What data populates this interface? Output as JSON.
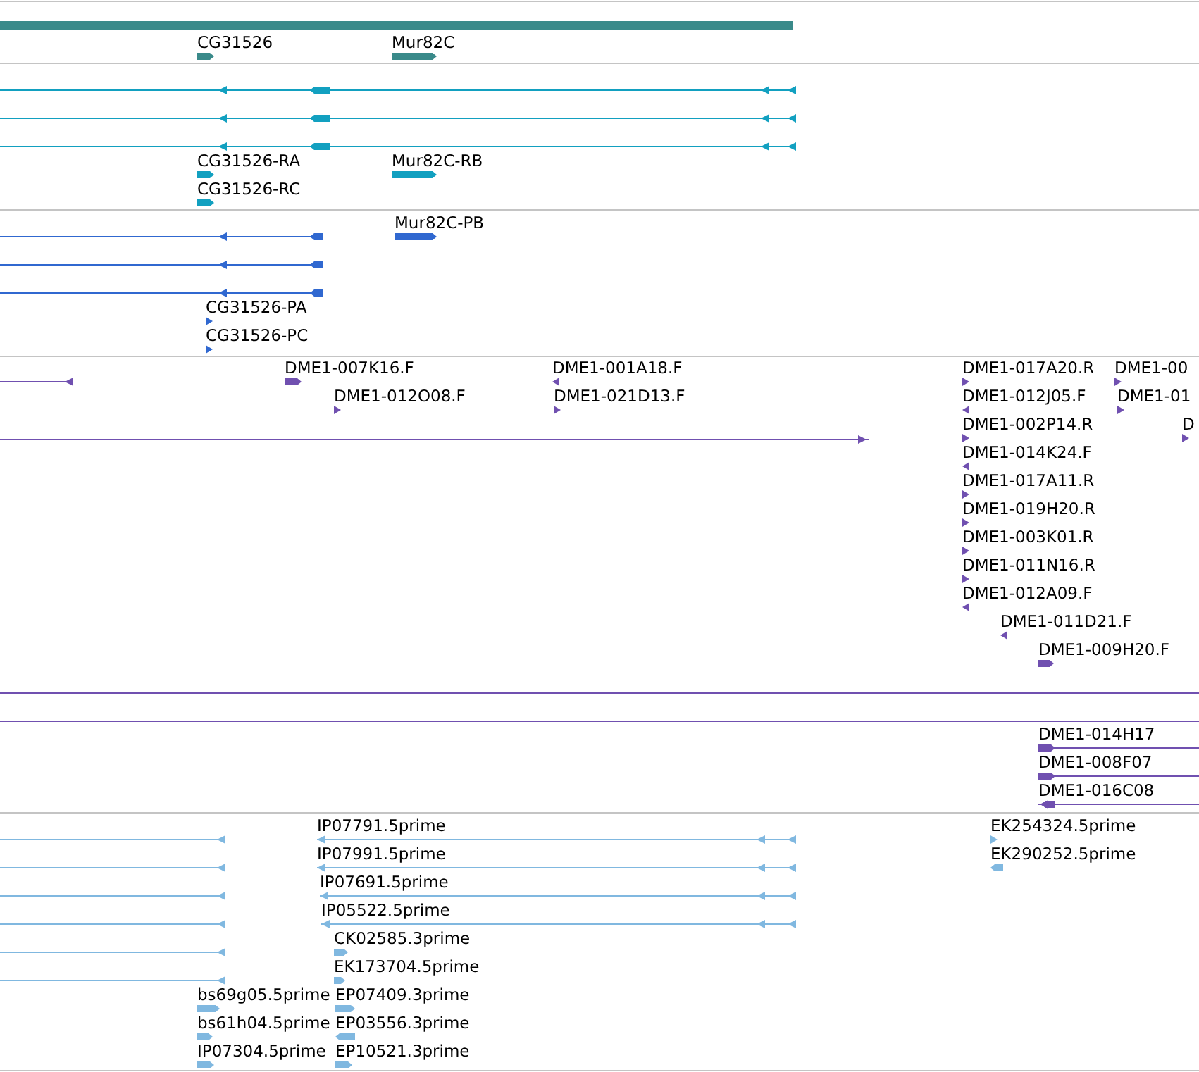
{
  "tracks": [
    {
      "color": "#3a8a8a",
      "features": [
        {
          "kind": "bar"
        },
        {
          "kind": "read",
          "label": "CG31526",
          "reverse": false
        },
        {
          "kind": "read",
          "label": "Mur82C",
          "reverse": false
        }
      ]
    },
    {
      "color": "#12a0c0",
      "features": [
        {
          "kind": "transcript",
          "reverse": true
        },
        {
          "kind": "transcript",
          "reverse": true
        },
        {
          "kind": "transcript",
          "reverse": true
        },
        {
          "kind": "read",
          "label": "CG31526-RA",
          "reverse": false
        },
        {
          "kind": "read",
          "label": "Mur82C-RB",
          "reverse": false
        },
        {
          "kind": "read",
          "label": "CG31526-RC",
          "reverse": false
        }
      ]
    },
    {
      "color": "#3068d0",
      "features": [
        {
          "kind": "read",
          "label": "Mur82C-PB",
          "reverse": false
        },
        {
          "kind": "transcript",
          "reverse": true
        },
        {
          "kind": "transcript",
          "reverse": true
        },
        {
          "kind": "transcript",
          "reverse": true
        },
        {
          "kind": "read",
          "label": "CG31526-PA",
          "reverse": false
        },
        {
          "kind": "read",
          "label": "CG31526-PC",
          "reverse": false
        }
      ]
    },
    {
      "color": "#7050b0",
      "features": [
        {
          "kind": "transcript",
          "reverse": true
        },
        {
          "kind": "read",
          "label": "DME1-007K16.F",
          "reverse": false
        },
        {
          "kind": "read",
          "label": "DME1-001A18.F",
          "reverse": true
        },
        {
          "kind": "read",
          "label": "DME1-017A20.R",
          "reverse": false
        },
        {
          "kind": "read",
          "label": "DME1-00",
          "reverse": false
        },
        {
          "kind": "read",
          "label": "DME1-012O08.F",
          "reverse": false
        },
        {
          "kind": "read",
          "label": "DME1-021D13.F",
          "reverse": false
        },
        {
          "kind": "read",
          "label": "DME1-012J05.F",
          "reverse": true
        },
        {
          "kind": "read",
          "label": "DME1-01",
          "reverse": false
        },
        {
          "kind": "transcript",
          "reverse": false
        },
        {
          "kind": "read",
          "label": "DME1-002P14.R",
          "reverse": false
        },
        {
          "kind": "read",
          "label": "D",
          "reverse": false
        },
        {
          "kind": "read",
          "label": "DME1-014K24.F",
          "reverse": true
        },
        {
          "kind": "read",
          "label": "DME1-017A11.R",
          "reverse": false
        },
        {
          "kind": "read",
          "label": "DME1-019H20.R",
          "reverse": false
        },
        {
          "kind": "read",
          "label": "DME1-003K01.R",
          "reverse": false
        },
        {
          "kind": "read",
          "label": "DME1-011N16.R",
          "reverse": false
        },
        {
          "kind": "read",
          "label": "DME1-012A09.F",
          "reverse": true
        },
        {
          "kind": "read",
          "label": "DME1-011D21.F",
          "reverse": true
        },
        {
          "kind": "read",
          "label": "DME1-009H20.F",
          "reverse": false
        },
        {
          "kind": "line"
        },
        {
          "kind": "line"
        },
        {
          "kind": "transcript",
          "label": "DME1-014H17",
          "reverse": false
        },
        {
          "kind": "transcript",
          "label": "DME1-008F07",
          "reverse": false
        },
        {
          "kind": "transcript",
          "label": "DME1-016C08",
          "reverse": true
        }
      ]
    },
    {
      "color": "#80b8e0",
      "features": [
        {
          "kind": "transcript",
          "reverse": true
        },
        {
          "kind": "transcript",
          "reverse": true
        },
        {
          "kind": "transcript",
          "reverse": true
        },
        {
          "kind": "transcript",
          "reverse": true
        },
        {
          "kind": "transcript",
          "reverse": true
        },
        {
          "kind": "transcript",
          "reverse": true
        },
        {
          "kind": "transcript",
          "label": "IP07791.5prime",
          "reverse": true
        },
        {
          "kind": "read",
          "label": "EK254324.5prime",
          "reverse": false
        },
        {
          "kind": "transcript",
          "label": "IP07991.5prime",
          "reverse": true
        },
        {
          "kind": "read",
          "label": "EK290252.5prime",
          "reverse": true
        },
        {
          "kind": "transcript",
          "label": "IP07691.5prime",
          "reverse": true
        },
        {
          "kind": "transcript",
          "label": "IP05522.5prime",
          "reverse": true
        },
        {
          "kind": "read",
          "label": "CK02585.3prime",
          "reverse": false
        },
        {
          "kind": "read",
          "label": "EK173704.5prime",
          "reverse": false
        },
        {
          "kind": "read",
          "label": "bs69g05.5prime",
          "reverse": false
        },
        {
          "kind": "read",
          "label": "EP07409.3prime",
          "reverse": false
        },
        {
          "kind": "read",
          "label": "bs61h04.5prime",
          "reverse": false
        },
        {
          "kind": "read",
          "label": "EP03556.3prime",
          "reverse": true
        },
        {
          "kind": "read",
          "label": "IP07304.5prime",
          "reverse": false
        },
        {
          "kind": "read",
          "label": "EP10521.3prime",
          "reverse": false
        }
      ]
    }
  ]
}
